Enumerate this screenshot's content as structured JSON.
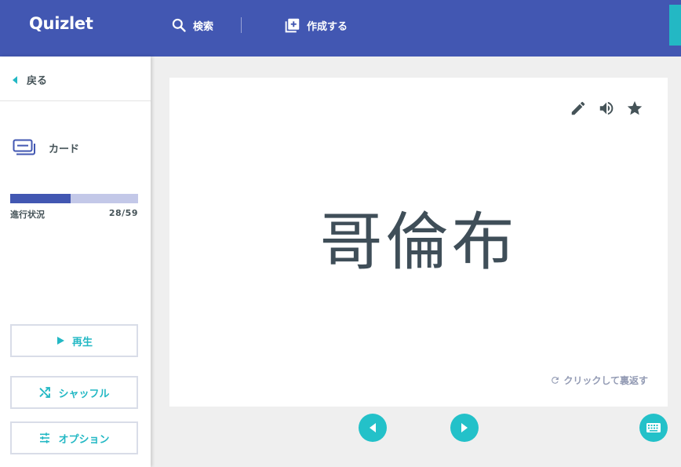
{
  "header": {
    "logo": "Quizlet",
    "search_label": "検索",
    "create_label": "作成する"
  },
  "sidebar": {
    "back_label": "戻る",
    "mode_label": "カード",
    "progress": {
      "label": "進行状況",
      "current": 28,
      "total": 59,
      "count_text": "28/59"
    },
    "buttons": {
      "play": "再生",
      "shuffle": "シャッフル",
      "options": "オプション"
    }
  },
  "card": {
    "term": "哥倫布",
    "flip_hint": "クリックして裏返す"
  },
  "icons": {
    "search": "search-icon",
    "create": "add-box-icon",
    "back": "caret-left-icon",
    "mode": "cards-icon",
    "play": "play-icon",
    "shuffle": "shuffle-icon",
    "options": "sliders-icon",
    "edit": "pencil-icon",
    "audio": "speaker-icon",
    "star": "star-icon",
    "flip": "refresh-icon",
    "prev": "prev-icon",
    "next": "next-icon",
    "keyboard": "keyboard-icon"
  },
  "colors": {
    "header_bg": "#4257b2",
    "accent": "#23b8c4",
    "text": "#455358",
    "progress_track": "#c3c8e8",
    "progress_fill": "#4257b2"
  }
}
